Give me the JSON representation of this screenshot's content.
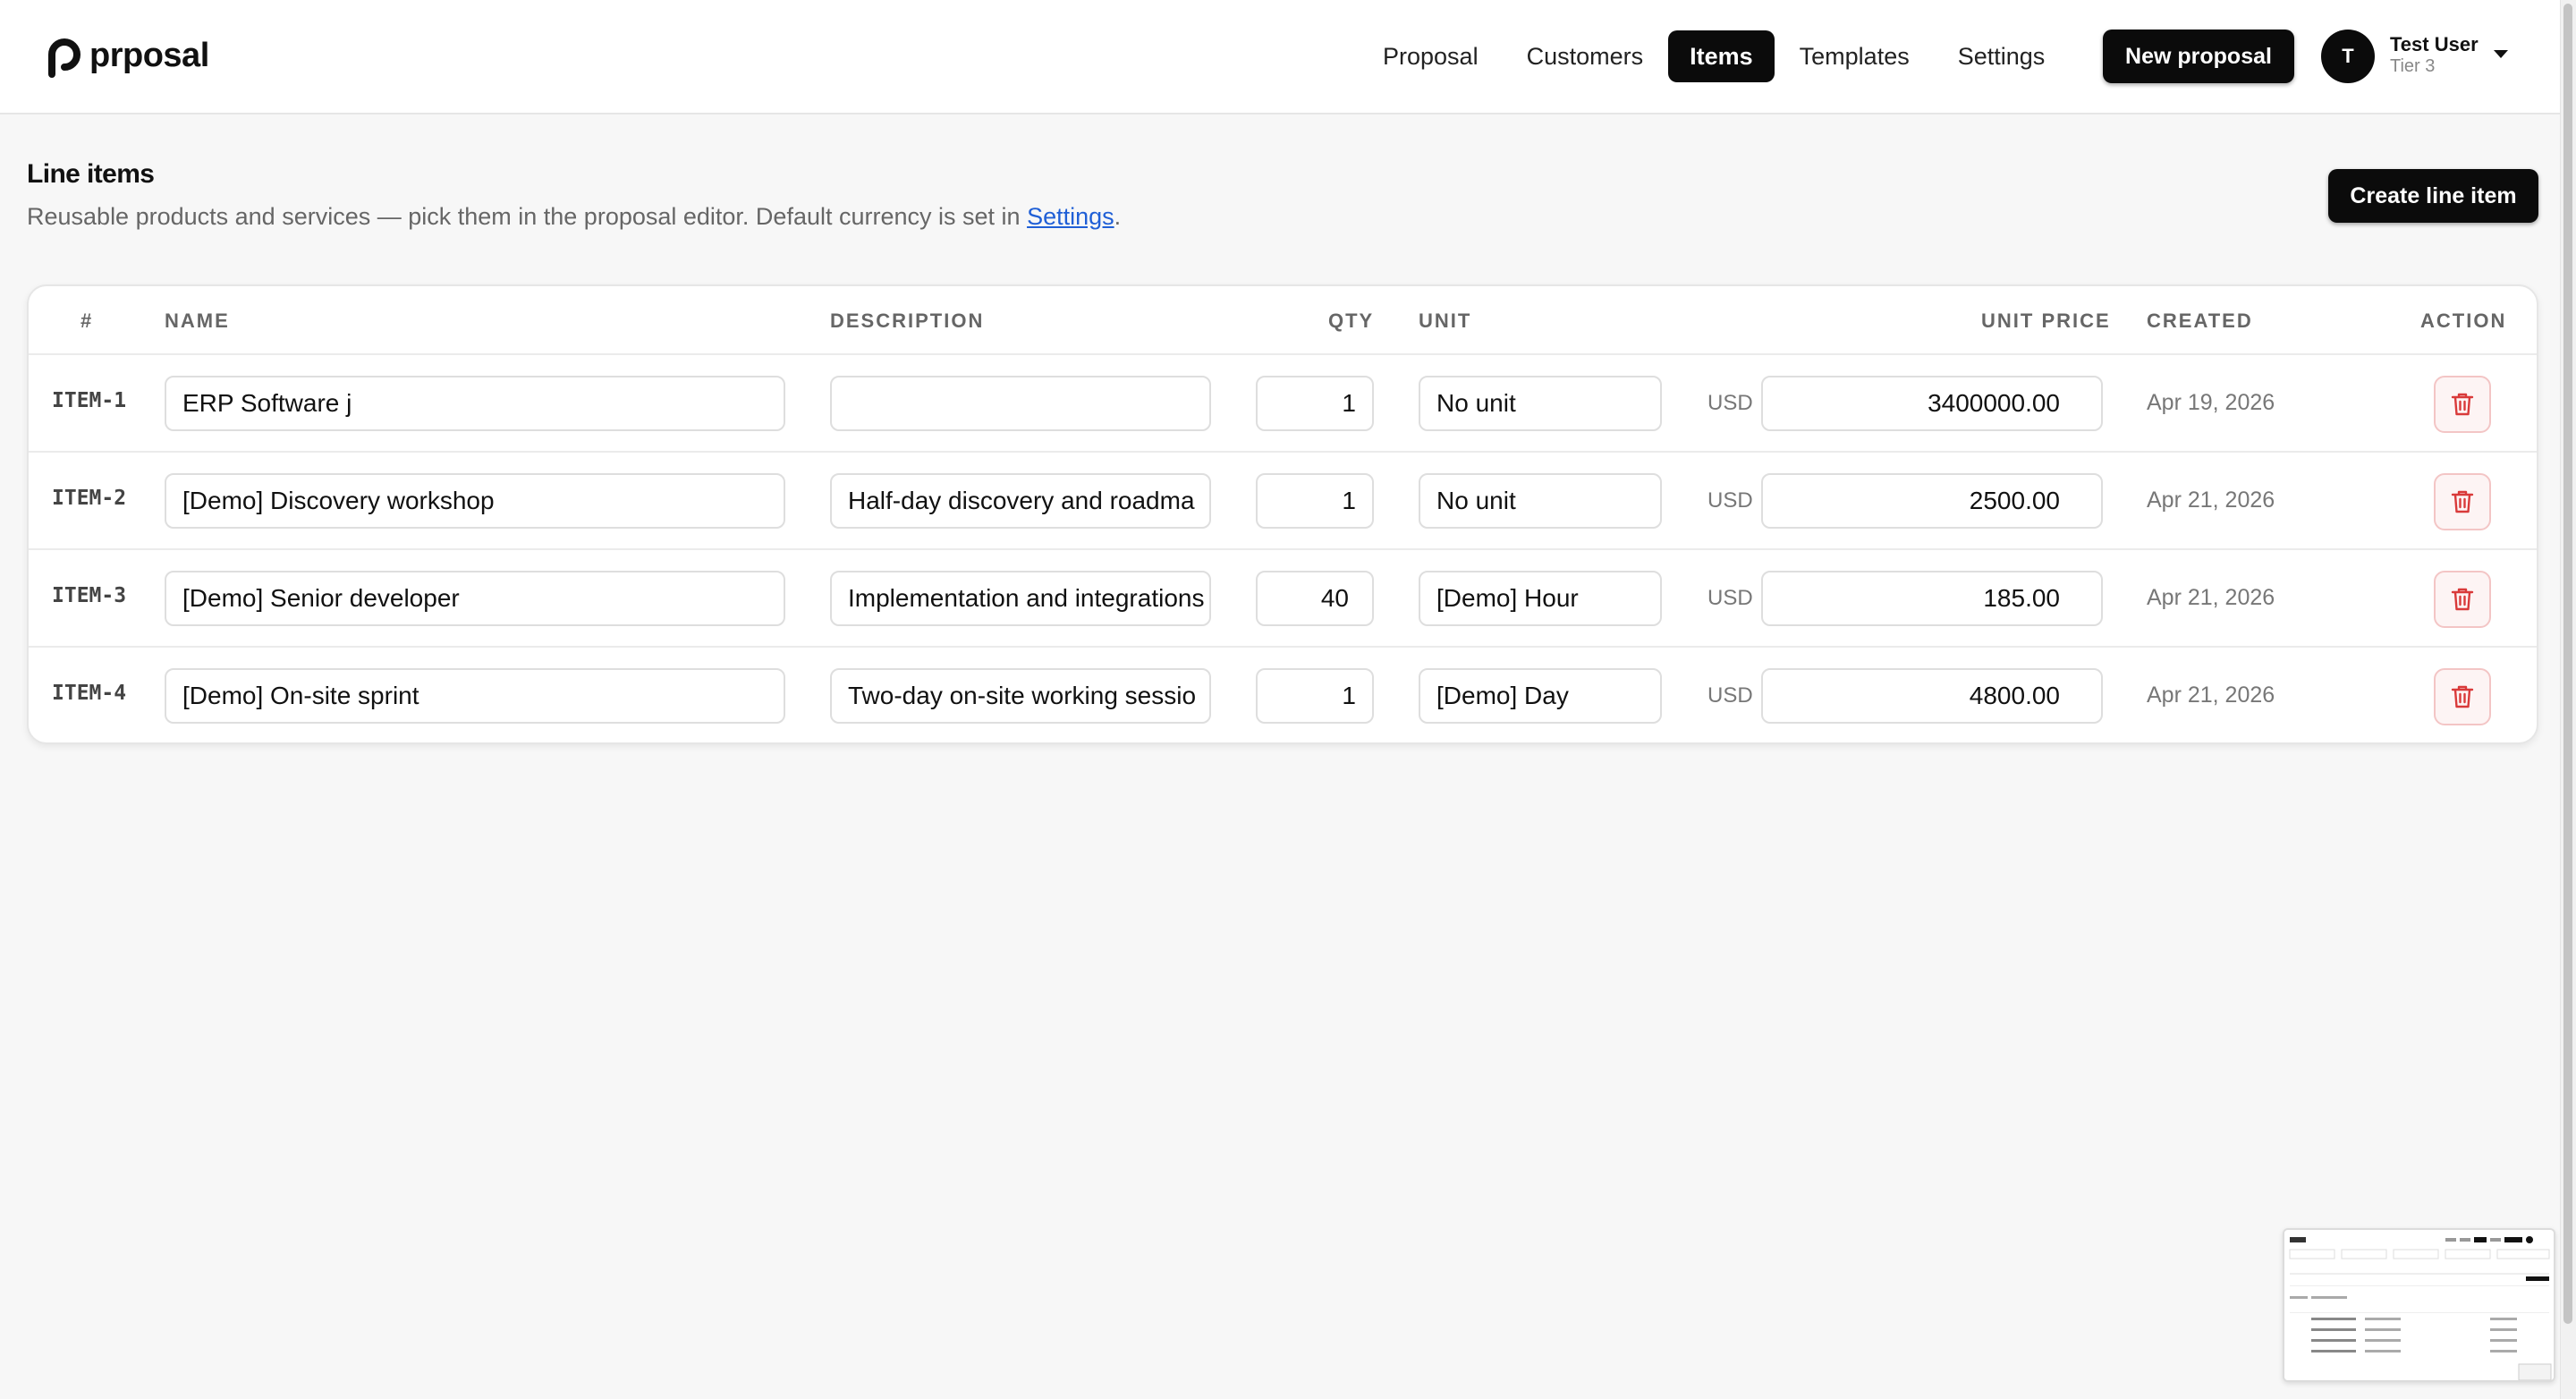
{
  "app": {
    "brand": "prposal"
  },
  "nav": {
    "items": [
      {
        "label": "Proposal"
      },
      {
        "label": "Customers"
      },
      {
        "label": "Items"
      },
      {
        "label": "Templates"
      },
      {
        "label": "Settings"
      }
    ],
    "active": "Items",
    "new_proposal_label": "New proposal"
  },
  "user": {
    "initial": "T",
    "name": "Test User",
    "tier": "Tier 3"
  },
  "page": {
    "title": "Line items",
    "subtitle_before": "Reusable products and services — pick them in the proposal editor. Default currency is set in ",
    "subtitle_link": "Settings",
    "subtitle_after": ".",
    "create_label": "Create line item"
  },
  "table": {
    "headers": {
      "num": "#",
      "name": "NAME",
      "description": "DESCRIPTION",
      "qty": "QTY",
      "unit": "UNIT",
      "unit_price": "UNIT PRICE",
      "created": "CREATED",
      "action": "ACTION"
    },
    "rows": [
      {
        "id": "ITEM-1",
        "name": "ERP Software j",
        "description": "",
        "qty": "1",
        "unit": "No unit",
        "currency": "USD",
        "price": "3400000.00",
        "created": "Apr 19, 2026"
      },
      {
        "id": "ITEM-2",
        "name": "[Demo] Discovery workshop",
        "description": "Half-day discovery and roadma",
        "qty": "1",
        "unit": "No unit",
        "currency": "USD",
        "price": "2500.00",
        "created": "Apr 21, 2026"
      },
      {
        "id": "ITEM-3",
        "name": "[Demo] Senior developer",
        "description": "Implementation and integrations",
        "qty": "40",
        "unit": "[Demo] Hour",
        "currency": "USD",
        "price": "185.00",
        "created": "Apr 21, 2026"
      },
      {
        "id": "ITEM-4",
        "name": "[Demo] On-site sprint",
        "description": "Two-day on-site working sessio",
        "qty": "1",
        "unit": "[Demo] Day",
        "currency": "USD",
        "price": "4800.00",
        "created": "Apr 21, 2026"
      }
    ]
  },
  "icons": {
    "logo": "prposal-logo-icon",
    "caret": "chevron-down-icon",
    "delete": "trash-icon"
  },
  "colors": {
    "accent_dark": "#0b0b0b",
    "link": "#1f5fd6",
    "danger": "#d93a3a"
  }
}
